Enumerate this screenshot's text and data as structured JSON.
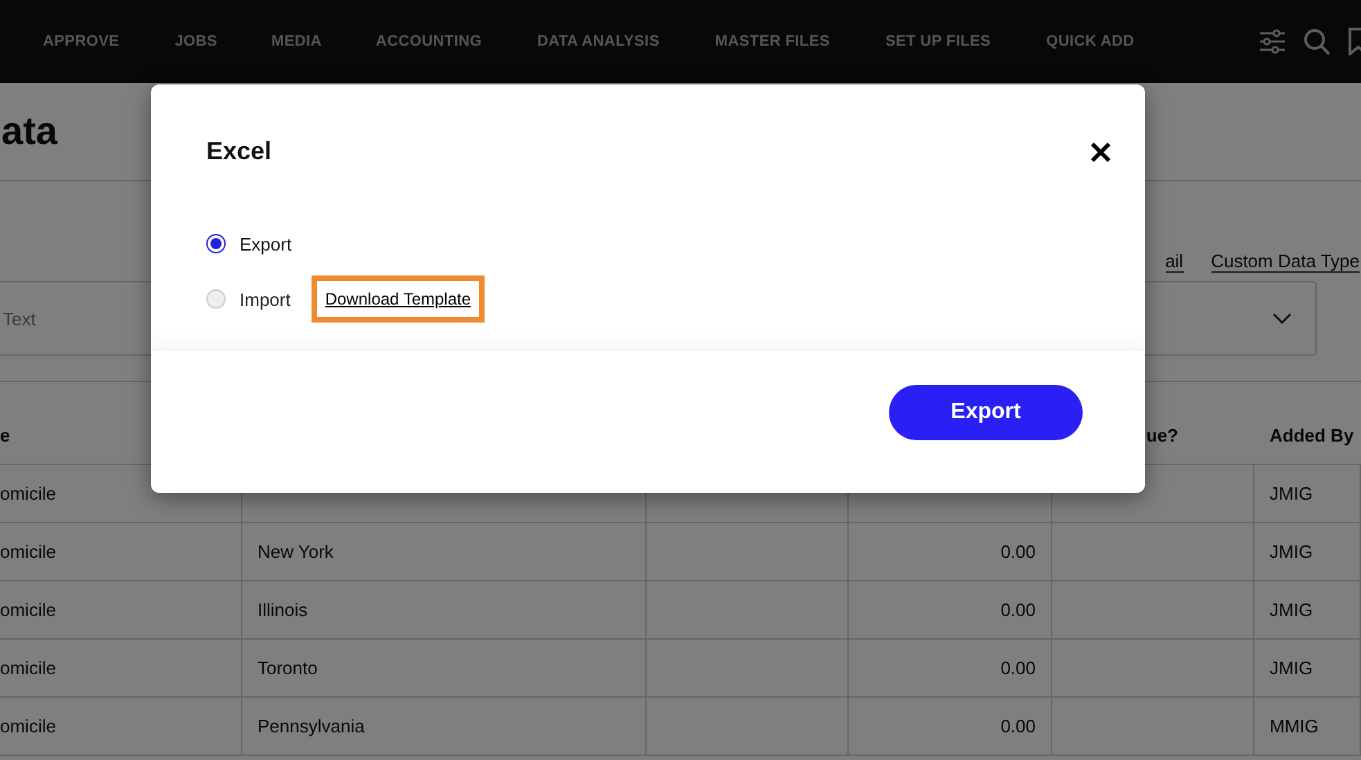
{
  "nav": {
    "items": [
      "APPROVE",
      "JOBS",
      "MEDIA",
      "ACCOUNTING",
      "DATA ANALYSIS",
      "MASTER FILES",
      "SET UP FILES",
      "QUICK ADD"
    ]
  },
  "page": {
    "title": "ata",
    "links": [
      "ail",
      "Custom Data Type"
    ],
    "filter": {
      "placeholder": "Text"
    },
    "table": {
      "columns": [
        "e",
        "",
        "",
        "",
        "ue?",
        "Added By"
      ],
      "rows": [
        [
          "omicile",
          "",
          "",
          "",
          "",
          "JMIG"
        ],
        [
          "omicile",
          "New York",
          "",
          "0.00",
          "",
          "JMIG"
        ],
        [
          "omicile",
          "Illinois",
          "",
          "0.00",
          "",
          "JMIG"
        ],
        [
          "omicile",
          "Toronto",
          "",
          "0.00",
          "",
          "JMIG"
        ],
        [
          "omicile",
          "Pennsylvania",
          "",
          "0.00",
          "",
          "MMIG"
        ]
      ]
    }
  },
  "modal": {
    "title": "Excel",
    "options": [
      {
        "label": "Export",
        "selected": true,
        "disabled": false
      },
      {
        "label": "Import",
        "selected": false,
        "disabled": true
      }
    ],
    "download_link": {
      "label": "Download Template",
      "highlighted": true
    },
    "button": "Export"
  }
}
